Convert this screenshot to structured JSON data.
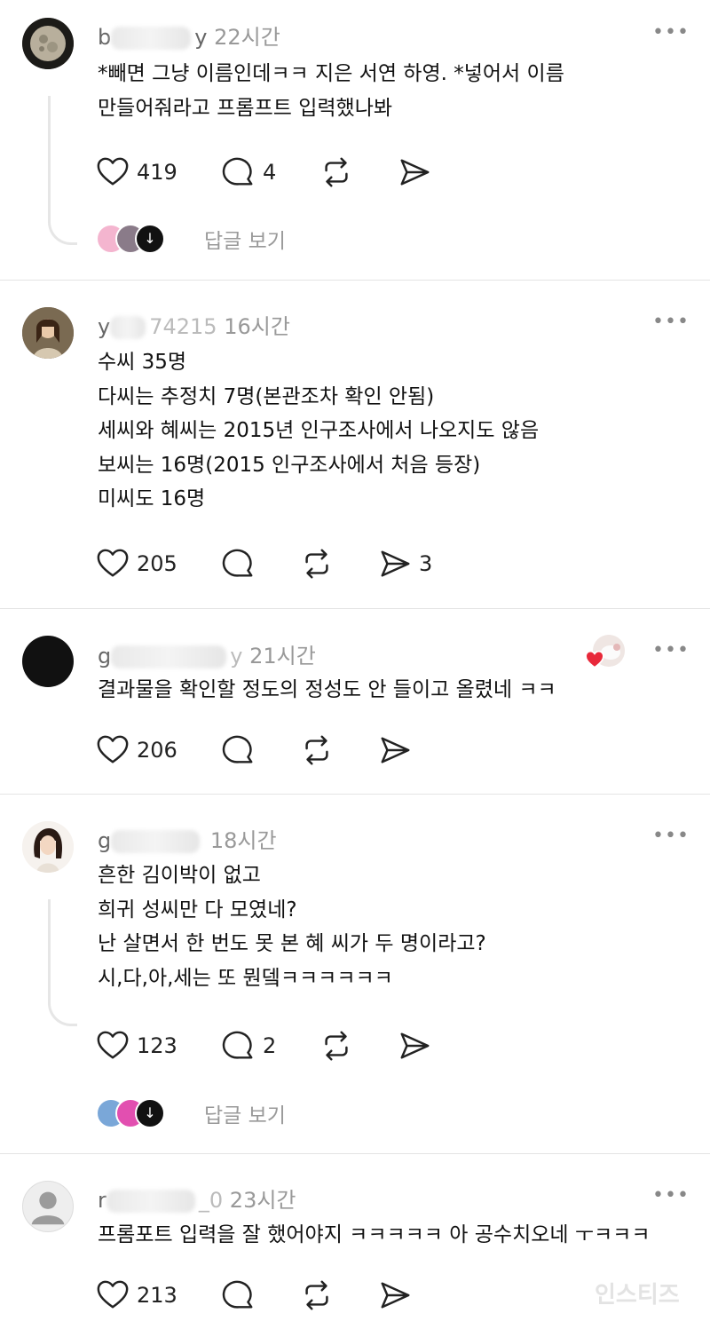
{
  "comments": [
    {
      "username_prefix": "b",
      "username_suffix": "y",
      "time": "22시간",
      "lines": [
        "*빼면 그냥 이름인데ㅋㅋ 지은 서연 하영. *넣어서 이름",
        "만들어줘라고 프롬프트 입력했나봐"
      ],
      "likes": "419",
      "replies_count": "4",
      "reposts": "",
      "shares": "",
      "view_replies": "답글 보기"
    },
    {
      "username_prefix": "y",
      "username_suffix": "74215",
      "time": "16시간",
      "lines": [
        "수씨 35명",
        "다씨는 추정치 7명(본관조차 확인 안됨)",
        "세씨와 혜씨는 2015년 인구조사에서 나오지도 않음",
        "보씨는 16명(2015 인구조사에서 처음 등장)",
        "미씨도 16명"
      ],
      "likes": "205",
      "replies_count": "",
      "reposts": "",
      "shares": "3"
    },
    {
      "username_prefix": "g",
      "username_suffix": "y",
      "time": "21시간",
      "lines": [
        "결과물을 확인할 정도의 정성도 안 들이고 올렸네 ㅋㅋ"
      ],
      "likes": "206",
      "replies_count": "",
      "reposts": "",
      "shares": ""
    },
    {
      "username_prefix": "g",
      "username_suffix": "",
      "time": "18시간",
      "lines": [
        "흔한 김이박이 없고",
        "희귀 성씨만 다 모였네?",
        "난 살면서 한 번도 못 본 혜 씨가 두 명이라고?",
        "시,다,아,세는 또 뭔뎈ㅋㅋㅋㅋㅋㅋ"
      ],
      "likes": "123",
      "replies_count": "2",
      "reposts": "",
      "shares": "",
      "view_replies": "답글 보기"
    },
    {
      "username_prefix": "r",
      "username_suffix": "_0",
      "time": "23시간",
      "lines": [
        "프롬포트 입력을 잘 했어야지 ㅋㅋㅋㅋㅋ 아 공수치오네 ㅜㅋㅋㅋ"
      ],
      "likes": "213",
      "replies_count": "",
      "reposts": "",
      "shares": ""
    }
  ],
  "more_label": "•••",
  "watermark": "인스티즈",
  "icons": {
    "like": "heart-icon",
    "comment": "comment-bubble-icon",
    "repost": "repost-icon",
    "share": "send-icon",
    "more": "more-dots-icon",
    "arrow": "arrow-down-icon"
  },
  "colors": {
    "text": "#111111",
    "muted": "#999999",
    "divider": "#e4e4e4",
    "heart_badge": "#e8283a"
  }
}
